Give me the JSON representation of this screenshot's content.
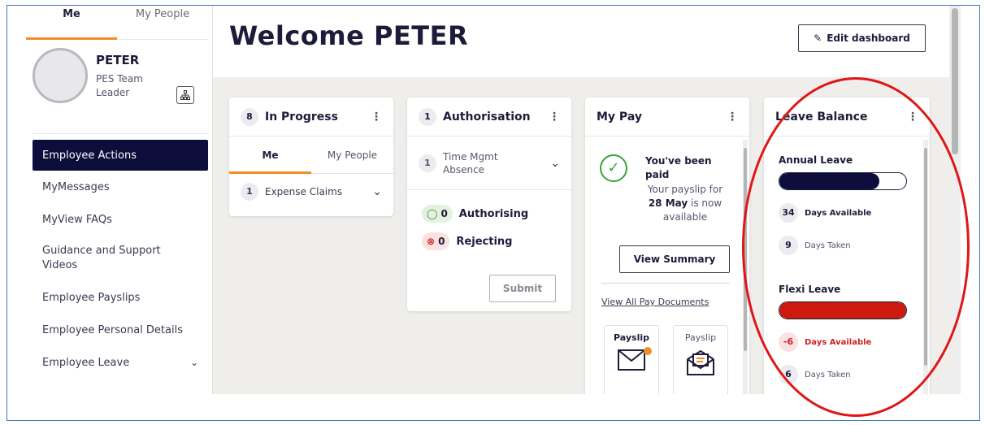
{
  "sidebar": {
    "tabs": [
      "Me",
      "My People"
    ],
    "profile": {
      "name": "PETER",
      "role": "PES Team Leader"
    },
    "menu": [
      {
        "label": "Employee Actions",
        "active": true
      },
      {
        "label": "MyMessages"
      },
      {
        "label": "MyView FAQs"
      },
      {
        "label": "Guidance and Support Videos"
      },
      {
        "label": "Employee Payslips"
      },
      {
        "label": "Employee Personal Details"
      },
      {
        "label": "Employee Leave"
      }
    ]
  },
  "header": {
    "welcome": "Welcome PETER",
    "edit_label": "Edit dashboard"
  },
  "in_progress": {
    "count": "8",
    "title": "In Progress",
    "tabs": [
      "Me",
      "My People"
    ],
    "item_count": "1",
    "item_label": "Expense Claims"
  },
  "authorisation": {
    "count": "1",
    "title": "Authorisation",
    "item_count": "1",
    "item_label": "Time Mgmt Absence",
    "authorising_count": "0",
    "authorising_label": "Authorising",
    "rejecting_count": "0",
    "rejecting_label": "Rejecting",
    "submit_label": "Submit"
  },
  "my_pay": {
    "title": "My Pay",
    "paid_title": "You've been paid",
    "paid_text_1": "Your payslip for",
    "paid_date": "28 May",
    "paid_text_2": "is now available",
    "view_summary": "View Summary",
    "view_all": "View All Pay Documents",
    "docs": [
      "Payslip",
      "Payslip"
    ]
  },
  "leave_balance": {
    "title": "Leave Balance",
    "annual": {
      "label": "Annual Leave",
      "available": "34",
      "available_label": "Days Available",
      "taken": "9",
      "taken_label": "Days Taken",
      "fill_pct": 79,
      "color": "#0d0d3b"
    },
    "flexi": {
      "label": "Flexi Leave",
      "available": "-6",
      "available_label": "Days Available",
      "taken": "6",
      "taken_label": "Days Taken",
      "fill_pct": 100,
      "color": "#cc1a0f"
    }
  },
  "colors": {
    "accent": "#f28c28",
    "navy": "#0d0d3b",
    "annotation": "#e01515"
  }
}
